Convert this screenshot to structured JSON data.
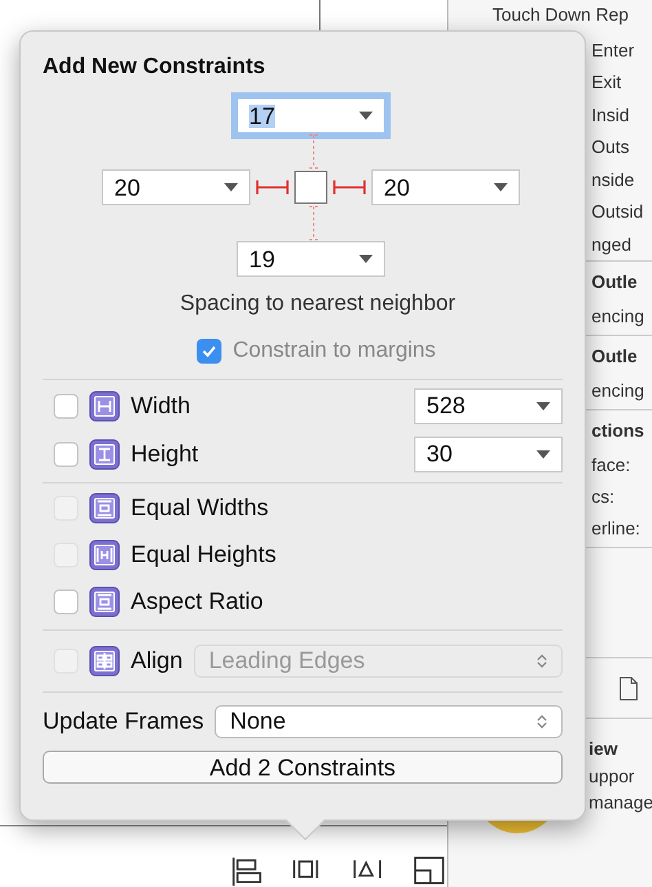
{
  "inspector": {
    "events": [
      "Touch Down Rep",
      "Enter",
      "Exit",
      "Insid",
      "Outs",
      "nside",
      "Outsid",
      "nged"
    ],
    "sections": [
      {
        "title": "Outle",
        "rows": [
          "encing"
        ]
      },
      {
        "title": "Outle",
        "rows": [
          "encing"
        ]
      },
      {
        "title": "ctions",
        "rows": [
          "face:",
          "cs:",
          "erline:"
        ]
      }
    ],
    "library": {
      "title": "iew",
      "lines": [
        "uppor",
        "manage"
      ]
    }
  },
  "popover": {
    "title": "Add New Constraints",
    "spacing": {
      "top": {
        "value": "17",
        "focused": true
      },
      "left": {
        "value": "20",
        "focused": false
      },
      "right": {
        "value": "20",
        "focused": false
      },
      "bottom": {
        "value": "19",
        "focused": false
      }
    },
    "spacing_label": "Spacing to nearest neighbor",
    "constrain_to_margins": {
      "label": "Constrain to margins",
      "checked": true
    },
    "size_rows": [
      {
        "label": "Width",
        "checked": false,
        "value": "528"
      },
      {
        "label": "Height",
        "checked": false,
        "value": "30"
      }
    ],
    "equal_rows": [
      {
        "label": "Equal Widths",
        "checked": false,
        "disabled": true
      },
      {
        "label": "Equal Heights",
        "checked": false,
        "disabled": true
      },
      {
        "label": "Aspect Ratio",
        "checked": false,
        "disabled": false
      }
    ],
    "align": {
      "label": "Align",
      "checked": false,
      "disabled": true,
      "value": "Leading Edges"
    },
    "update_frames": {
      "label": "Update Frames",
      "value": "None"
    },
    "add_button": "Add 2 Constraints"
  }
}
